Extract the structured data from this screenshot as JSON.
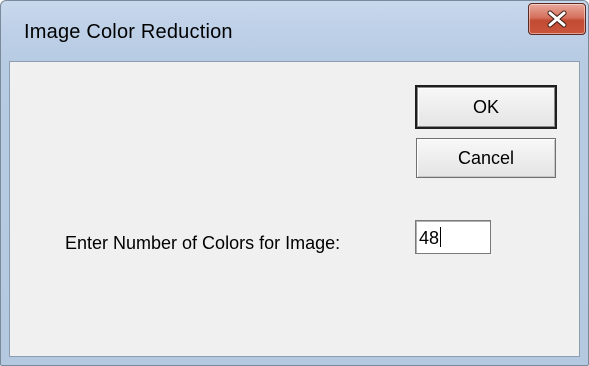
{
  "window": {
    "title": "Image Color Reduction"
  },
  "titlebar": {
    "close_icon": "close-icon"
  },
  "dialog": {
    "ok_label": "OK",
    "cancel_label": "Cancel",
    "colors_label": "Enter Number of Colors for Image:",
    "colors_value": "48"
  },
  "colors": {
    "close_button": "#c9553c",
    "client_background": "#f0f0f0",
    "frame": "#b7cbe3"
  }
}
